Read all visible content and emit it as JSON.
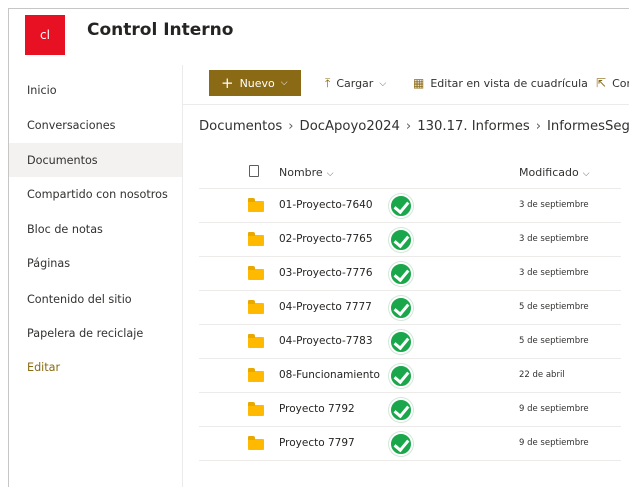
{
  "site": {
    "logo_text": "cl",
    "title": "Control Interno"
  },
  "nav": {
    "items": [
      {
        "label": "Inicio"
      },
      {
        "label": "Conversaciones"
      },
      {
        "label": "Documentos"
      },
      {
        "label": "Compartido con nosotros"
      },
      {
        "label": "Bloc de notas"
      },
      {
        "label": "Páginas"
      },
      {
        "label": "Contenido del sitio"
      },
      {
        "label": "Papelera de reciclaje"
      },
      {
        "label": "Editar"
      }
    ],
    "active": "Documentos"
  },
  "toolbar": {
    "new_label": "Nuevo",
    "upload_label": "Cargar",
    "grid_label": "Editar en vista de cuadrícula",
    "share_label": "Com"
  },
  "breadcrumb": {
    "items": [
      "Documentos",
      "DocApoyo2024",
      "130.17. Informes",
      "InformesSeg"
    ]
  },
  "list": {
    "columns": {
      "name": "Nombre",
      "modified": "Modificado"
    },
    "rows": [
      {
        "name": "01-Proyecto-7640",
        "modified": "3 de septiembre"
      },
      {
        "name": "02-Proyecto-7765",
        "modified": "3 de septiembre"
      },
      {
        "name": "03-Proyecto-7776",
        "modified": "3 de septiembre"
      },
      {
        "name": "04-Proyecto 7777",
        "modified": "5 de septiembre"
      },
      {
        "name": "04-Proyecto-7783",
        "modified": "5 de septiembre"
      },
      {
        "name": "08-Funcionamiento",
        "modified": "22 de abril"
      },
      {
        "name": "Proyecto 7792",
        "modified": "9 de septiembre"
      },
      {
        "name": "Proyecto 7797",
        "modified": "9 de septiembre"
      }
    ]
  },
  "colors": {
    "brand": "#e81123",
    "accent": "#8a6a14",
    "folder": "#ffb900",
    "check": "#1aa64a"
  }
}
